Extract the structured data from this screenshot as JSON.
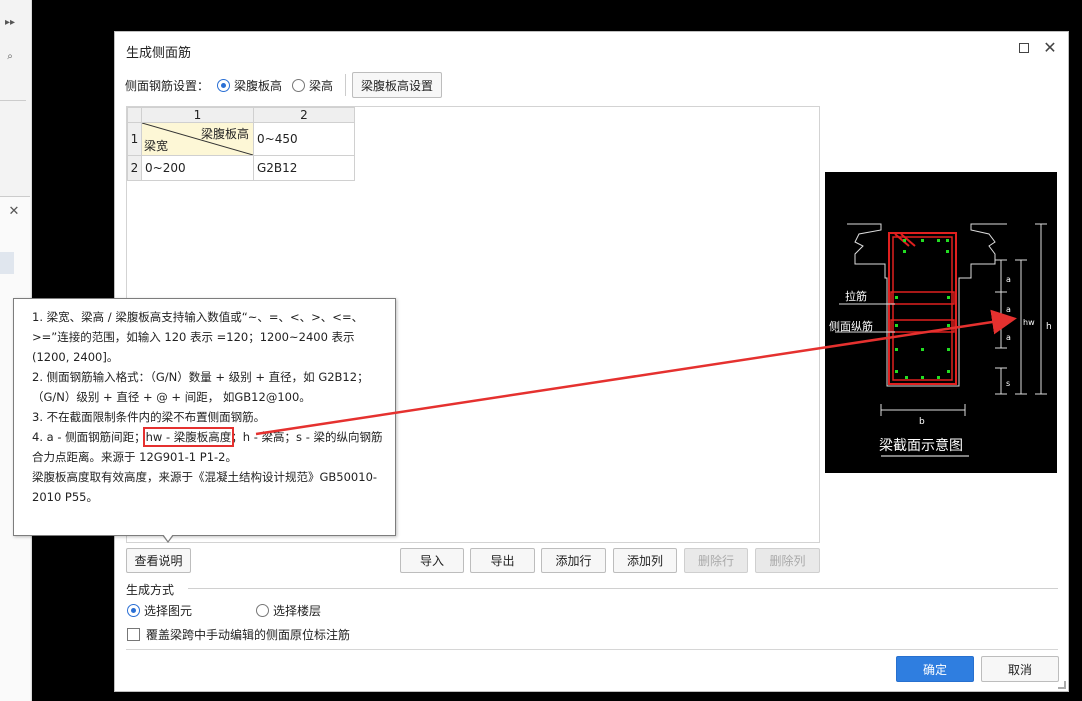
{
  "dialog": {
    "title": "生成侧面筋"
  },
  "settings": {
    "label": "侧面钢筋设置：",
    "options": [
      "梁腹板高",
      "梁高"
    ],
    "selected": "梁腹板高",
    "button": "梁腹板高设置"
  },
  "grid": {
    "column_headers": [
      "1",
      "2"
    ],
    "row_headers": [
      "1",
      "2"
    ],
    "corner_top_right": "梁腹板高",
    "corner_bottom_left": "梁宽",
    "rows": [
      [
        "",
        "0~450"
      ],
      [
        "0~200",
        "G2B12"
      ]
    ]
  },
  "tooltip": {
    "line1": "1. 梁宽、梁高 / 梁腹板高支持输入数值或“~、=、<、>、<=、>=”连接的范围，如输入 120 表示 =120；1200~2400 表示 (1200, 2400]。",
    "line2": "2. 侧面钢筋输入格式：（G/N）数量 + 级别 + 直径，如 G2B12；（G/N）级别 + 直径 + @ + 间距， 如GB12@100。",
    "line3": "3. 不在截面限制条件内的梁不布置侧面钢筋。",
    "line4_a": "4. a - 侧面钢筋间距；",
    "line4_hw": "hw - 梁腹板高度",
    "line4_b": "；h - 梁高；s - 梁的纵向钢筋合力点距离。来源于 12G901-1 P1-2。",
    "line5": "梁腹板高度取有效高度，来源于《混凝土结构设计规范》GB50010-2010 P55。"
  },
  "actions": {
    "view_help": "查看说明",
    "import": "导入",
    "export": "导出",
    "add_row": "添加行",
    "add_col": "添加列",
    "del_row": "删除行",
    "del_col": "删除列"
  },
  "diagram": {
    "caption": "梁截面示意图",
    "label_tie": "拉筋",
    "label_side": "侧面纵筋",
    "dim_a": "a",
    "dim_hw": "hw",
    "dim_h": "h",
    "dim_s": "s",
    "dim_b": "b"
  },
  "generate": {
    "label": "生成方式",
    "options": [
      "选择图元",
      "选择楼层"
    ],
    "selected": "选择图元",
    "override_label": "覆盖梁跨中手动编辑的侧面原位标注筋",
    "override_checked": false
  },
  "footer": {
    "ok": "确定",
    "cancel": "取消"
  },
  "colors": {
    "accent": "#2f7ee0",
    "highlight": "#e5312f",
    "rebar": "#e0201f",
    "rebar_dot": "#22dd22"
  }
}
